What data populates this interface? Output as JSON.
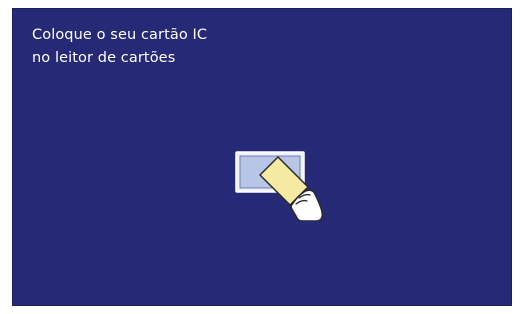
{
  "screen": {
    "instruction_line_1": "Coloque o seu cartão IC",
    "instruction_line_2": "no leitor de cartões",
    "icon": "insert-ic-card-icon",
    "colors": {
      "background": "#262a76",
      "text": "#ffffff",
      "reader": "#c9d6ee",
      "card": "#f6e9a2",
      "hand": "#ffffff"
    }
  }
}
